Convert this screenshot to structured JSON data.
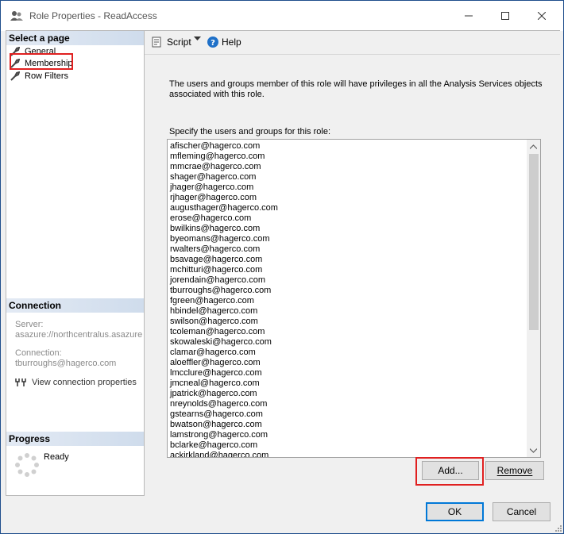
{
  "window": {
    "title": "Role Properties - ReadAccess"
  },
  "left": {
    "select_page_header": "Select a page",
    "pages": [
      {
        "label": "General"
      },
      {
        "label": "Membership"
      },
      {
        "label": "Row Filters"
      }
    ],
    "connection_header": "Connection",
    "server_label": "Server:",
    "server_value": "asazure://northcentralus.asazure.windows.net",
    "connection_label": "Connection:",
    "connection_value": "tburroughs@hagerco.com",
    "view_connection_link": "View connection properties",
    "progress_header": "Progress",
    "progress_status": "Ready"
  },
  "toolbar": {
    "script_label": "Script",
    "help_label": "Help"
  },
  "main": {
    "description": "The users and groups member of this role will have privileges in all the Analysis Services objects associated with this role.",
    "specify_label": "Specify the users and groups for this role:",
    "members": [
      "afischer@hagerco.com",
      "mfleming@hagerco.com",
      "mmcrae@hagerco.com",
      "shager@hagerco.com",
      "jhager@hagerco.com",
      "rjhager@hagerco.com",
      "augusthager@hagerco.com",
      "erose@hagerco.com",
      "bwilkins@hagerco.com",
      "byeomans@hagerco.com",
      "rwalters@hagerco.com",
      "bsavage@hagerco.com",
      "mchitturi@hagerco.com",
      "jorendain@hagerco.com",
      "tburroughs@hagerco.com",
      "fgreen@hagerco.com",
      "hbindel@hagerco.com",
      "swilson@hagerco.com",
      "tcoleman@hagerco.com",
      "skowaleski@hagerco.com",
      "clamar@hagerco.com",
      "aloeffler@hagerco.com",
      "lmcclure@hagerco.com",
      "jmcneal@hagerco.com",
      "jpatrick@hagerco.com",
      "nreynolds@hagerco.com",
      "gstearns@hagerco.com",
      "bwatson@hagerco.com",
      "lamstrong@hagerco.com",
      "bclarke@hagerco.com",
      "ackirkland@hagerco.com"
    ],
    "add_label": "Add...",
    "remove_label": "Remove"
  },
  "footer": {
    "ok_label": "OK",
    "cancel_label": "Cancel"
  },
  "colors": {
    "highlight_box": "#e02020",
    "header_gradient": "#cfdcec",
    "default_button_border": "#0078d7"
  }
}
